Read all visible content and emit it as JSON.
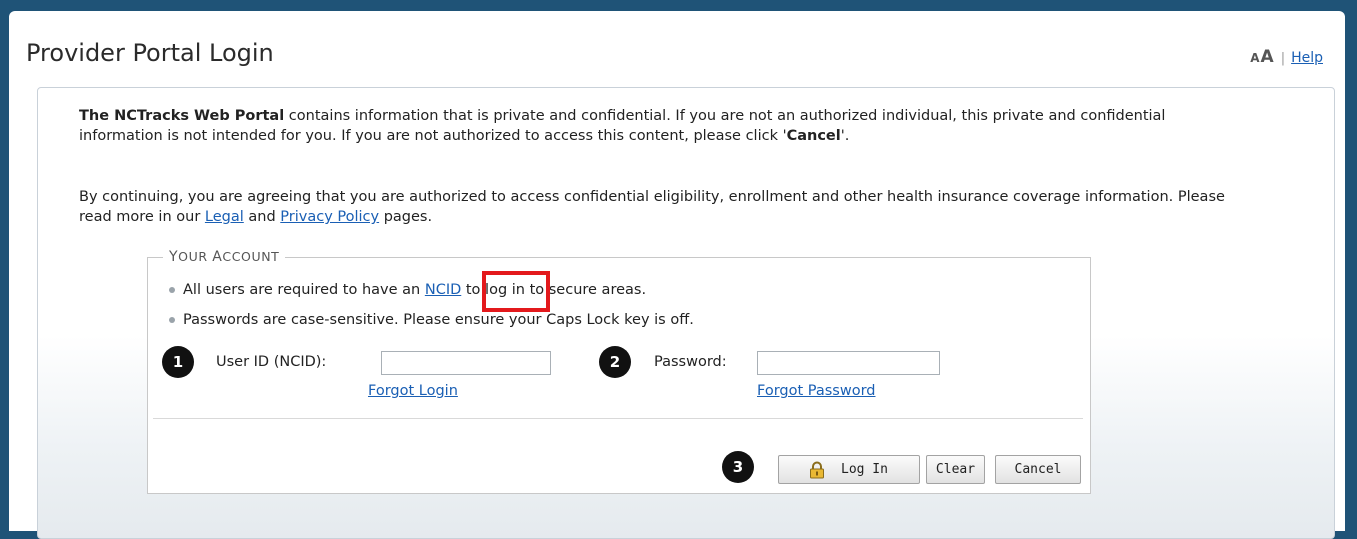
{
  "header": {
    "title": "Provider Portal Login",
    "text_size_small": "A",
    "text_size_large": "A",
    "separator": "|",
    "help_label": "Help"
  },
  "notice": {
    "para1_bold": "The NCTracks Web Portal",
    "para1_text": " contains information that is private and confidential. If you are not an authorized individual, this private and confidential information is not intended for you. If you are not authorized to access this content, please click '",
    "para1_cancel": "Cancel",
    "para1_end": "'.",
    "para2_text": "By continuing, you are agreeing that you are authorized to access confidential eligibility, enrollment and other health insurance coverage information. Please read more in our ",
    "legal_link": "Legal",
    "and_text": " and ",
    "privacy_link": "Privacy Policy",
    "para2_end": " pages."
  },
  "account": {
    "legend_y": "Y",
    "legend_rest1": "OUR ",
    "legend_a": "A",
    "legend_rest2": "CCOUNT",
    "bullet1_pre": "All users are required to have an ",
    "ncid_link": "NCID",
    "bullet1_post": " to log in to secure areas.",
    "bullet2": "Passwords are case-sensitive. Please ensure your Caps Lock key is off.",
    "user_label": "User ID (NCID):",
    "user_value": "",
    "password_label": "Password:",
    "password_value": "",
    "forgot_login": "Forgot Login",
    "forgot_password": "Forgot Password"
  },
  "markers": [
    "1",
    "2",
    "3"
  ],
  "buttons": {
    "login": "Log In",
    "clear": "Clear",
    "cancel": "Cancel"
  },
  "colors": {
    "frame": "#1f5377",
    "link": "#1a5fb4",
    "highlight": "#e3191c"
  },
  "icons": {
    "login": "lock-icon"
  }
}
